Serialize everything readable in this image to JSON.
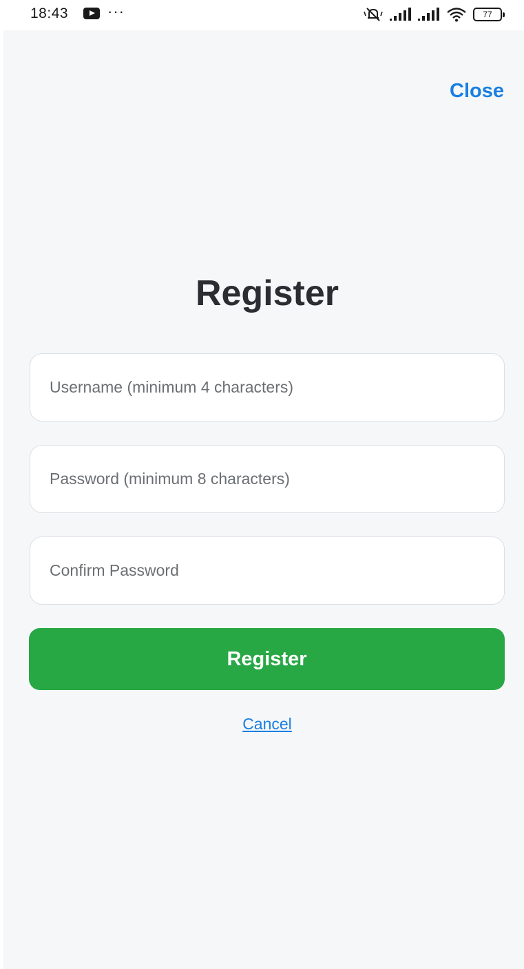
{
  "status_bar": {
    "time": "18:43",
    "more_indicator": "···",
    "battery_level": "77",
    "icons": [
      "youtube-icon",
      "mute-icon",
      "signal-icon",
      "signal-icon",
      "wifi-icon",
      "battery-icon"
    ]
  },
  "header": {
    "close_label": "Close"
  },
  "form": {
    "title": "Register",
    "username_placeholder": "Username (minimum 4 characters)",
    "username_value": "",
    "password_placeholder": "Password (minimum 8 characters)",
    "password_value": "",
    "confirm_placeholder": "Confirm Password",
    "confirm_value": "",
    "submit_label": "Register",
    "cancel_label": "Cancel"
  },
  "colors": {
    "accent_blue": "#1a7fe0",
    "submit_green": "#28a745",
    "background": "#f5f7f9",
    "title_text": "#2a2d31"
  }
}
